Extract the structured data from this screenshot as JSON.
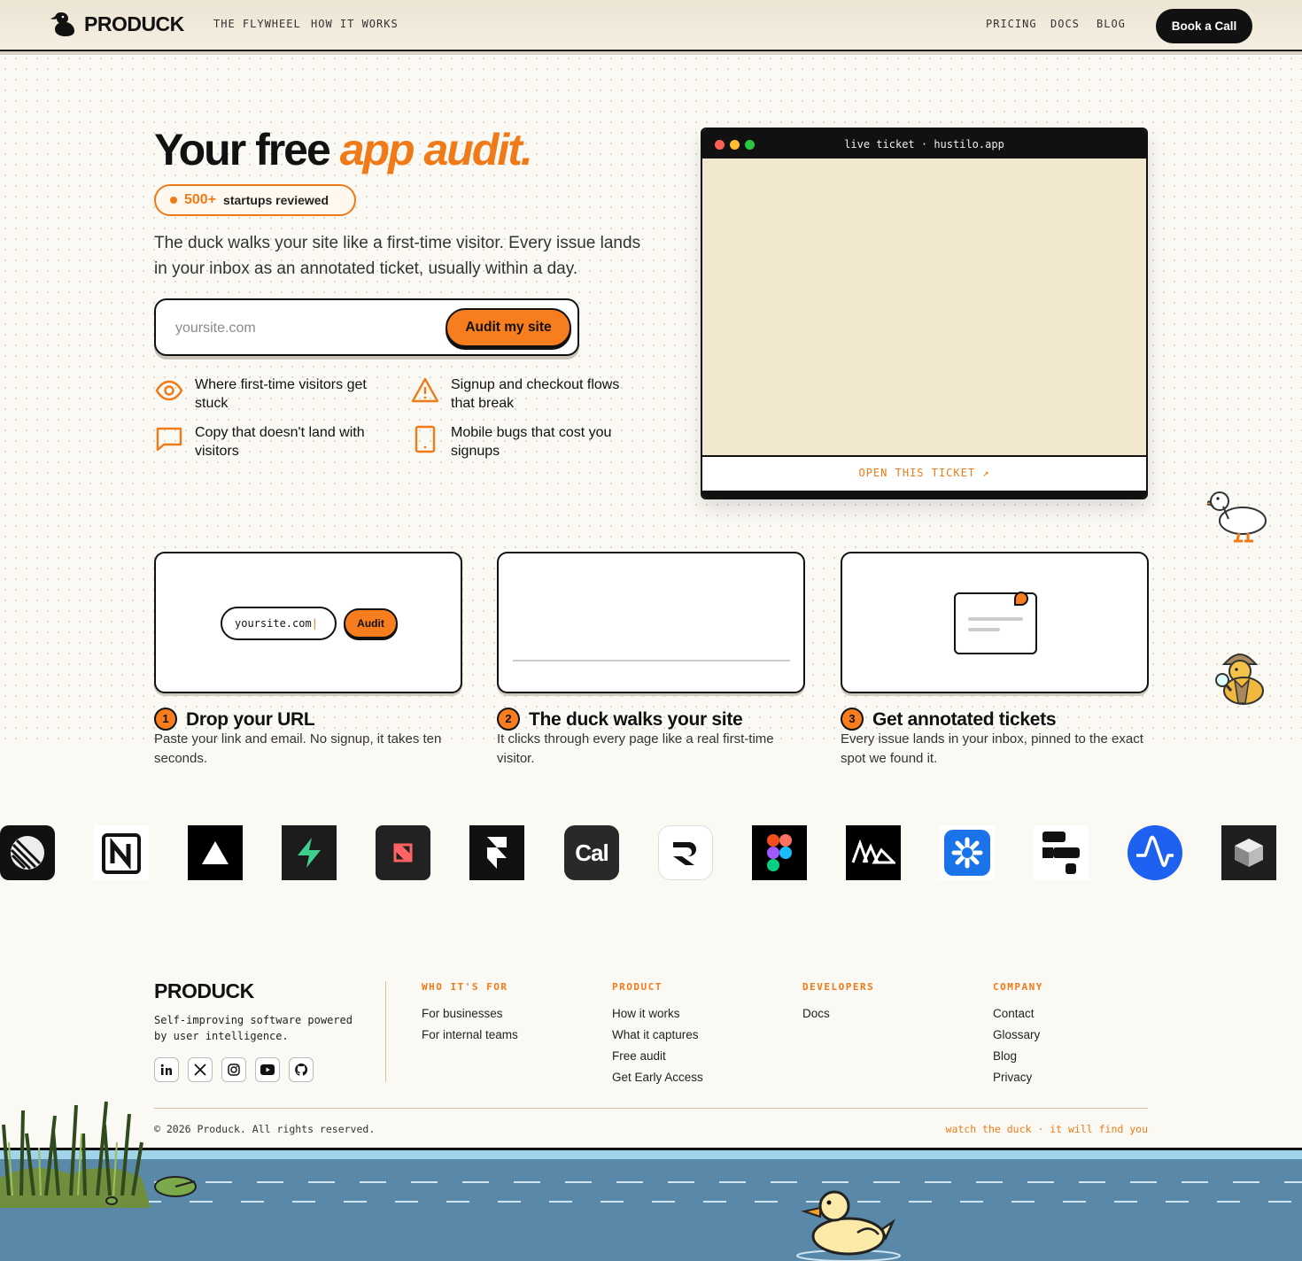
{
  "brand": {
    "name": "PRODUCK"
  },
  "nav": {
    "left": [
      "THE FLYWHEEL",
      "HOW IT WORKS"
    ],
    "right": [
      "PRICING",
      "DOCS",
      "BLOG"
    ],
    "cta": "Book a Call"
  },
  "hero": {
    "title_plain": "Your free",
    "title_accent": "app audit.",
    "badge_count": "500+",
    "badge_text": "startups reviewed",
    "subtitle": "The duck walks your site like a first-time visitor. Every issue lands in your inbox as an annotated ticket, usually within a day.",
    "input_placeholder": "yoursite.com",
    "submit_label": "Audit my site",
    "features": [
      {
        "icon": "eye-icon",
        "text": "Where first-time visitors get stuck"
      },
      {
        "icon": "warning-icon",
        "text": "Signup and checkout flows that break"
      },
      {
        "icon": "chat-bubble-icon",
        "text": "Copy that doesn't land with visitors"
      },
      {
        "icon": "mobile-icon",
        "text": "Mobile bugs that cost you signups"
      }
    ]
  },
  "ticket": {
    "title": "live ticket · hustilo.app",
    "open_label": "OPEN THIS TICKET ↗"
  },
  "steps": [
    {
      "num": "1",
      "title": "Drop your URL",
      "desc": "Paste your link and email. No signup, it takes ten seconds.",
      "mock_input": "yoursite.com",
      "mock_button": "Audit"
    },
    {
      "num": "2",
      "title": "The duck walks your site",
      "desc": "It clicks through every page like a real first-time visitor."
    },
    {
      "num": "3",
      "title": "Get annotated tickets",
      "desc": "Every issue lands in your inbox, pinned to the exact spot we found it."
    }
  ],
  "logos": [
    "linear-logo",
    "notion-logo",
    "vercel-logo",
    "supabase-logo",
    "raycast-logo",
    "framer-logo",
    "cal-logo",
    "raycast-r-logo",
    "figma-logo",
    "pitch-logo",
    "zapier-logo",
    "render-logo",
    "amplitude-logo",
    "replit-cube-logo"
  ],
  "logo_texts": {
    "cal": "Cal"
  },
  "footer": {
    "brand": "PRODUCK",
    "tagline": "Self-improving software powered by user intelligence.",
    "socials": [
      "linkedin-icon",
      "x-icon",
      "instagram-icon",
      "youtube-icon",
      "github-icon"
    ],
    "columns": [
      {
        "heading": "WHO IT'S FOR",
        "links": [
          "For businesses",
          "For internal teams"
        ]
      },
      {
        "heading": "PRODUCT",
        "links": [
          "How it works",
          "What it captures",
          "Free audit",
          "Get Early Access"
        ]
      },
      {
        "heading": "DEVELOPERS",
        "links": [
          "Docs"
        ]
      },
      {
        "heading": "COMPANY",
        "links": [
          "Contact",
          "Glossary",
          "Blog",
          "Privacy"
        ]
      }
    ],
    "copyright": "© 2026 Produck. All rights reserved.",
    "watch_note": "watch the duck · it will find you"
  },
  "colors": {
    "accent": "#f07a17",
    "ink": "#111111",
    "cream": "#f2e7cf",
    "pond": "#5a88a8"
  }
}
